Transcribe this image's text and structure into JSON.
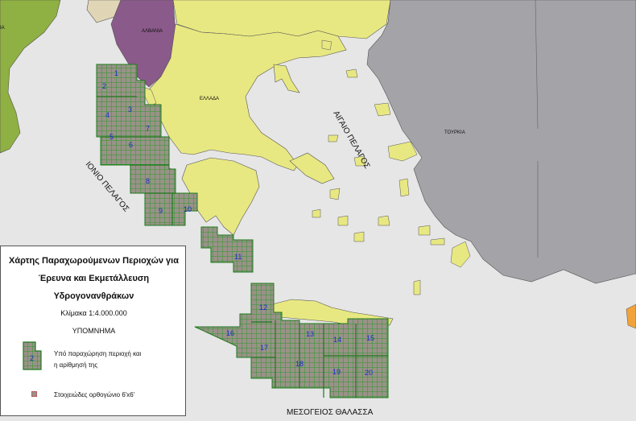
{
  "map": {
    "colors": {
      "sea": "#e6e6e6",
      "greece": "#e8e882",
      "turkey": "#a3a3a8",
      "albania": "#8a5a8a",
      "italy": "#8fb042",
      "balkans": "#e0d6b6",
      "block_fill": "#9a9288",
      "block_grid": "#2b9b2b",
      "block_number": "#1a2bd0"
    },
    "country_labels": {
      "albania": "ΑΛΒΑΝΙΑ",
      "greece": "ΕΛΛΑΔΑ",
      "turkey": "ΤΟΥΡΚΙΑ",
      "italy_partial": "ΙΑ"
    },
    "sea_labels": {
      "ionian": "ΙΟΝΙΟ ΠΕΛΑΓΟΣ",
      "aegean": "ΑΙΓΑΙΟ ΠΕΛΑΓΟΣ",
      "mediterranean": "ΜΕΣΟΓΕΙΟΣ ΘΑΛΑΣΣΑ"
    },
    "block_numbers": [
      "1",
      "2",
      "3",
      "4",
      "5",
      "6",
      "7",
      "8",
      "9",
      "10",
      "11",
      "12",
      "13",
      "14",
      "15",
      "16",
      "17",
      "18",
      "19",
      "20"
    ]
  },
  "legend": {
    "title_line1": "Χάρτης Παραχωρούμενων Περιοχών για",
    "title_line2": "Έρευνα και Εκμετάλλευση",
    "title_line3": "Υδρογονανθράκων",
    "scale": "Κλίμακα 1:4.000.000",
    "header": "ΥΠΟΜΝΗΜΑ",
    "sample_block_number": "2",
    "item1_line1": "Υπό παραχώρηση περιοχή και",
    "item1_line2": "η αρίθμησή της",
    "item2": "Στοιχειώδες ορθογώνιο 6'x6'"
  }
}
